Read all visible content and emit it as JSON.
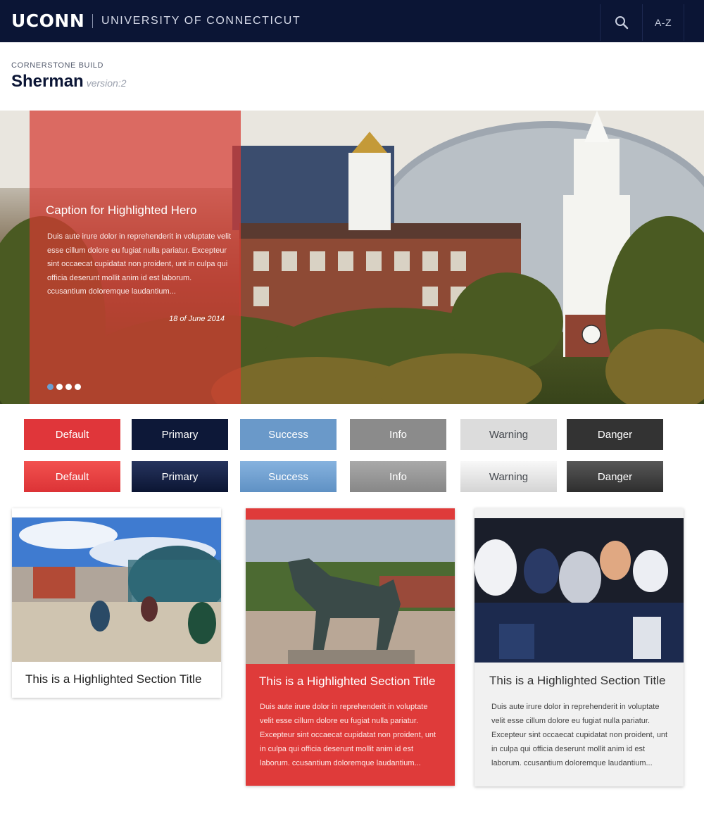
{
  "header": {
    "logo": "UCONN",
    "university": "UNIVERSITY OF CONNECTICUT",
    "search_icon": "search-icon",
    "az_label": "A-Z"
  },
  "site": {
    "eyebrow": "CORNERSTONE BUILD",
    "title": "Sherman",
    "version": "version:2"
  },
  "hero": {
    "caption_title": "Caption for Highlighted Hero",
    "caption_body": "Duis aute irure dolor in reprehenderit in voluptate velit esse cillum dolore eu fugiat nulla pariatur. Excepteur sint occaecat cupidatat non proident, unt in culpa qui officia deserunt mollit anim id est laborum. ccusantium doloremque laudantium...",
    "date": "18 of June 2014",
    "slide_count": 4,
    "active_slide": 1
  },
  "buttons": {
    "flat": [
      "Default",
      "Primary",
      "Success",
      "Info",
      "Warning",
      "Danger"
    ],
    "gradient": [
      "Default",
      "Primary",
      "Success",
      "Info",
      "Warning",
      "Danger"
    ]
  },
  "cards": [
    {
      "title": "This is a Highlighted Section Title"
    },
    {
      "title": "This is a Highlighted Section Title",
      "body": "Duis aute irure dolor in reprehenderit in voluptate velit esse cillum dolore eu fugiat nulla pariatur. Excepteur sint occaecat cupidatat non proident, unt in culpa qui officia deserunt mollit anim id est laborum. ccusantium doloremque laudantium..."
    },
    {
      "title": "This is a Highlighted Section Title",
      "body": "Duis aute irure dolor in reprehenderit in voluptate velit esse cillum dolore eu fugiat nulla pariatur. Excepteur sint occaecat cupidatat non proident, unt in culpa qui officia deserunt mollit anim id est laborum. ccusantium doloremque laudantium..."
    }
  ],
  "colors": {
    "navy": "#0b1535",
    "red": "#e0363a",
    "blue": "#6a99c9",
    "gray": "#8b8b8b",
    "light_gray": "#dcdcdc",
    "charcoal": "#333333"
  }
}
